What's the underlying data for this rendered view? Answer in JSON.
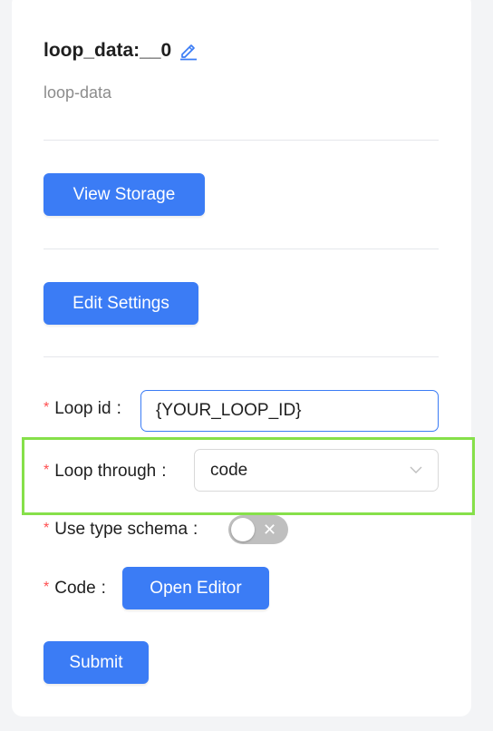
{
  "header": {
    "title": "loop_data:__0",
    "subtitle": "loop-data"
  },
  "actions": {
    "view_storage_label": "View Storage",
    "edit_settings_label": "Edit Settings"
  },
  "form": {
    "required_marker": "*",
    "loop_id": {
      "label": "Loop id",
      "separator": ":",
      "value": "{YOUR_LOOP_ID}"
    },
    "loop_through": {
      "label": "Loop through",
      "separator": ":",
      "selected": "code"
    },
    "use_type_schema": {
      "label": "Use type schema",
      "separator": ":",
      "toggle_off_symbol": "✕",
      "enabled": false
    },
    "code": {
      "label": "Code",
      "separator": ":",
      "button_label": "Open Editor"
    },
    "submit_label": "Submit"
  },
  "colors": {
    "primary": "#3b7cf5",
    "required": "#ff4d4f",
    "highlight": "#86e04a",
    "toggle_off": "#bfbfbf"
  }
}
